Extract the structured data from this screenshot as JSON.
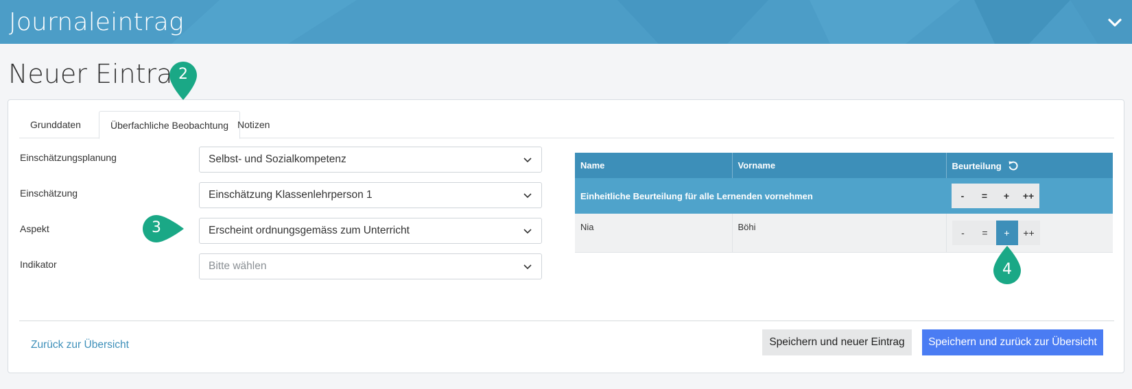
{
  "header": {
    "app_title": "Journaleintrag",
    "collapse_icon": "chevron-down-icon"
  },
  "page": {
    "title": "Neuer Eintrag"
  },
  "tabs": [
    {
      "label": "Grunddaten",
      "active": false
    },
    {
      "label": "Überfachliche Beobachtung",
      "active": true
    },
    {
      "label": "Notizen",
      "active": false
    }
  ],
  "form": {
    "planning": {
      "label": "Einschätzungsplanung",
      "value": "Selbst- und Sozialkompetenz"
    },
    "assessment": {
      "label": "Einschätzung",
      "value": "Einschätzung Klassenlehrperson 1"
    },
    "aspect": {
      "label": "Aspekt",
      "value": "Erscheint ordnungsgemäss zum Unterricht"
    },
    "indicator": {
      "label": "Indikator",
      "placeholder": "Bitte wählen"
    }
  },
  "table": {
    "headers": {
      "name": "Name",
      "firstname": "Vorname",
      "rating": "Beurteilung"
    },
    "bulk_label": "Einheitliche Beurteilung für alle Lernenden vornehmen",
    "rating_options": [
      "-",
      "=",
      "+",
      "++"
    ],
    "rows": [
      {
        "name": "Nia",
        "firstname": "Böhi",
        "rating": "+"
      }
    ]
  },
  "footer": {
    "back_link": "Zurück zur Übersicht",
    "save_new": "Speichern und neuer Eintrag",
    "save_back": "Speichern und zurück zur Übersicht"
  },
  "markers": {
    "m2": "2",
    "m3": "3",
    "m4": "4"
  },
  "colors": {
    "header_bg": "#4c9dc7",
    "table_header": "#3d8fb9",
    "primary_button": "#4a7cf3",
    "marker": "#1aa886"
  }
}
